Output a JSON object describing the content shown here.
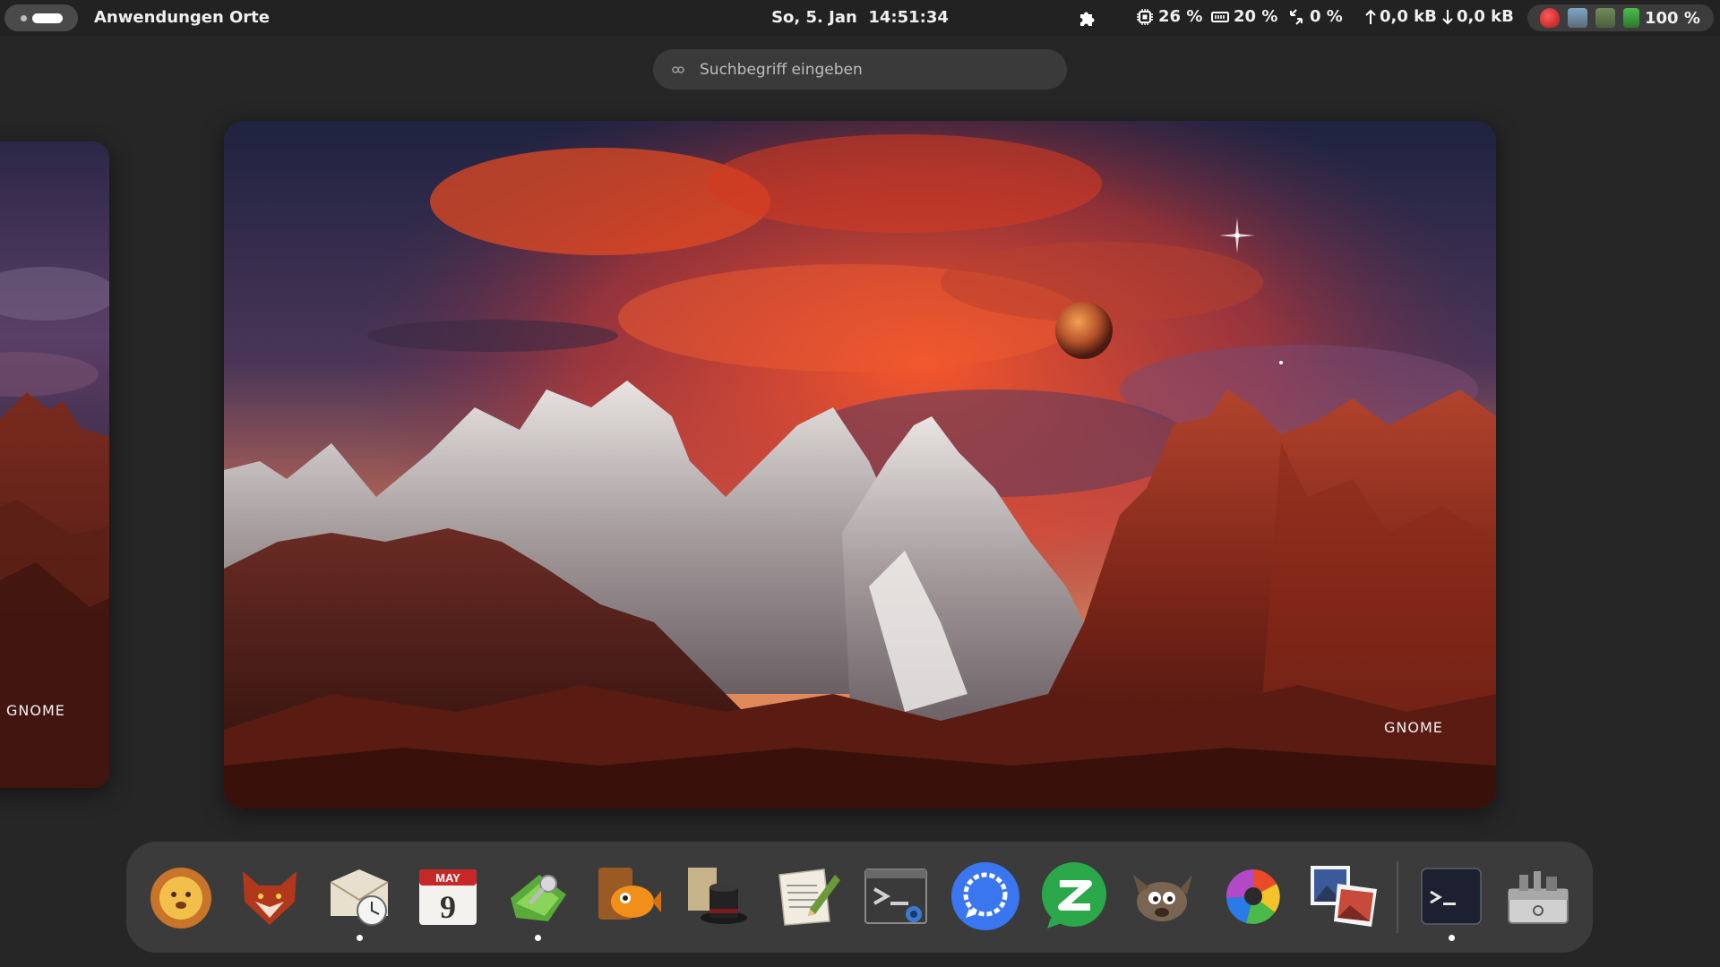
{
  "topbar": {
    "activities_label": "",
    "menu": {
      "applications": "Anwendungen",
      "places": "Orte"
    },
    "clock": "So, 5. Jan  14:51:34",
    "indicators": {
      "cpu": "26 %",
      "memory": "20 %",
      "swap": "0 %",
      "upload": "0,0 kB",
      "download": "0,0 kB",
      "battery": "100 %"
    },
    "tray_icons": [
      "red-app-icon",
      "globe-tray-icon",
      "chip-tray-icon",
      "battery-tray-icon"
    ]
  },
  "search": {
    "placeholder": "Suchbegriff eingeben"
  },
  "workspaces": {
    "main_label": "GNOME",
    "side_label": "GNOME"
  },
  "dock": {
    "apps": [
      {
        "name": "lion-app-icon",
        "running": false
      },
      {
        "name": "fox-app-icon",
        "running": false
      },
      {
        "name": "mail-clock-app-icon",
        "running": true
      },
      {
        "name": "calendar-app-icon",
        "running": false,
        "month": "MAY",
        "day": "9"
      },
      {
        "name": "keyring-app-icon",
        "running": true
      },
      {
        "name": "fish-app-icon",
        "running": false
      },
      {
        "name": "top-hat-app-icon",
        "running": false
      },
      {
        "name": "text-editor-app-icon",
        "running": false
      },
      {
        "name": "terminal-settings-app-icon",
        "running": false
      },
      {
        "name": "signal-app-icon",
        "running": false
      },
      {
        "name": "z-chat-app-icon",
        "running": false
      },
      {
        "name": "gimp-app-icon",
        "running": false
      },
      {
        "name": "color-wheel-app-icon",
        "running": false
      },
      {
        "name": "image-viewer-app-icon",
        "running": false
      },
      {
        "name": "terminal-app-icon",
        "running": true
      },
      {
        "name": "toolbox-app-icon",
        "running": false
      }
    ]
  },
  "colors": {
    "panel_bg": "#222222",
    "dock_bg": "#3b3b3b",
    "search_bg": "#3a3a3a",
    "signal_blue": "#3a76f0",
    "chat_green": "#2aa84a"
  }
}
